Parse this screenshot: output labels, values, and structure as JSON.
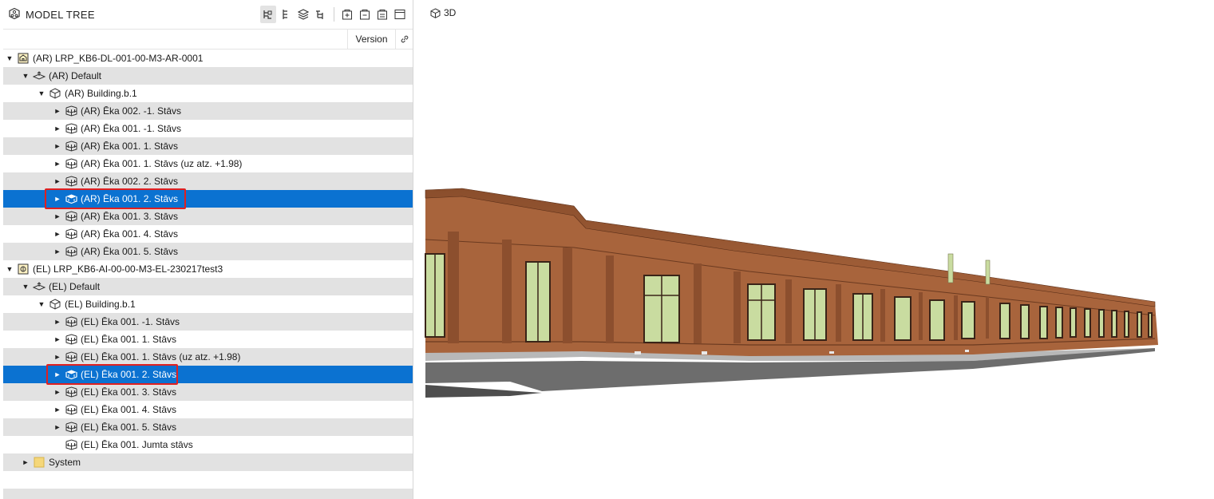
{
  "panel": {
    "title": "MODEL TREE",
    "version_col": "Version"
  },
  "viewport": {
    "tab_label": "3D"
  },
  "tree": [
    {
      "label": "(AR) LRP_KB6-DL-001-00-M3-AR-0001",
      "level": 0,
      "arrow": "down",
      "icon": "ar-model-icon",
      "selected": false
    },
    {
      "label": "(AR) Default",
      "level": 1,
      "arrow": "down",
      "icon": "layer-default-icon",
      "selected": false
    },
    {
      "label": "(AR) Building.b.1",
      "level": 2,
      "arrow": "down",
      "icon": "building-cube-icon",
      "selected": false
    },
    {
      "label": "(AR) Ēka 002.  -1. Stāvs",
      "level": 3,
      "arrow": "right",
      "icon": "storey-icon",
      "selected": false
    },
    {
      "label": "(AR) Ēka 001. -1. Stāvs",
      "level": 3,
      "arrow": "right",
      "icon": "storey-icon",
      "selected": false
    },
    {
      "label": "(AR) Ēka 001. 1. Stāvs",
      "level": 3,
      "arrow": "right",
      "icon": "storey-icon",
      "selected": false
    },
    {
      "label": "(AR) Ēka 001. 1. Stāvs (uz atz. +1.98)",
      "level": 3,
      "arrow": "right",
      "icon": "storey-icon",
      "selected": false
    },
    {
      "label": "(AR) Ēka 002. 2. Stāvs",
      "level": 3,
      "arrow": "right",
      "icon": "storey-icon",
      "selected": false
    },
    {
      "label": "(AR) Ēka 001. 2. Stāvs",
      "level": 3,
      "arrow": "right",
      "icon": "storey-icon",
      "selected": true
    },
    {
      "label": "(AR) Ēka 001. 3. Stāvs",
      "level": 3,
      "arrow": "right",
      "icon": "storey-icon",
      "selected": false
    },
    {
      "label": "(AR) Ēka 001. 4. Stāvs",
      "level": 3,
      "arrow": "right",
      "icon": "storey-icon",
      "selected": false
    },
    {
      "label": "(AR) Ēka 001. 5. Stāvs",
      "level": 3,
      "arrow": "right",
      "icon": "storey-icon",
      "selected": false
    },
    {
      "label": "(EL) LRP_KB6-AI-00-00-M3-EL-230217test3",
      "level": 0,
      "arrow": "down",
      "icon": "el-model-icon",
      "selected": false
    },
    {
      "label": "(EL) Default",
      "level": 1,
      "arrow": "down",
      "icon": "layer-default-icon",
      "selected": false
    },
    {
      "label": "(EL) Building.b.1",
      "level": 2,
      "arrow": "down",
      "icon": "building-cube-icon",
      "selected": false
    },
    {
      "label": "(EL) Ēka 001. -1. Stāvs",
      "level": 3,
      "arrow": "right",
      "icon": "storey-icon",
      "selected": false
    },
    {
      "label": "(EL) Ēka 001. 1. Stāvs",
      "level": 3,
      "arrow": "right",
      "icon": "storey-icon",
      "selected": false
    },
    {
      "label": "(EL) Ēka 001. 1. Stāvs (uz atz. +1.98)",
      "level": 3,
      "arrow": "right",
      "icon": "storey-icon",
      "selected": false
    },
    {
      "label": "(EL) Ēka 001. 2. Stāvs",
      "level": 3,
      "arrow": "right",
      "icon": "storey-icon",
      "selected": true
    },
    {
      "label": "(EL) Ēka 001. 3. Stāvs",
      "level": 3,
      "arrow": "right",
      "icon": "storey-icon",
      "selected": false
    },
    {
      "label": "(EL) Ēka 001. 4. Stāvs",
      "level": 3,
      "arrow": "right",
      "icon": "storey-icon",
      "selected": false
    },
    {
      "label": "(EL) Ēka 001. 5. Stāvs",
      "level": 3,
      "arrow": "right",
      "icon": "storey-icon",
      "selected": false
    },
    {
      "label": "(EL) Ēka 001. Jumta stāvs",
      "level": 3,
      "arrow": "none",
      "icon": "storey-icon",
      "selected": false
    },
    {
      "label": "System",
      "level": 1,
      "arrow": "right",
      "icon": "folder-icon",
      "selected": false
    }
  ],
  "colors": {
    "selection": "#0b72d1",
    "highlight_box": "#e02020",
    "facade": "#a8643c",
    "window_glass": "#c9dca0",
    "folder": "#f5d77a"
  }
}
